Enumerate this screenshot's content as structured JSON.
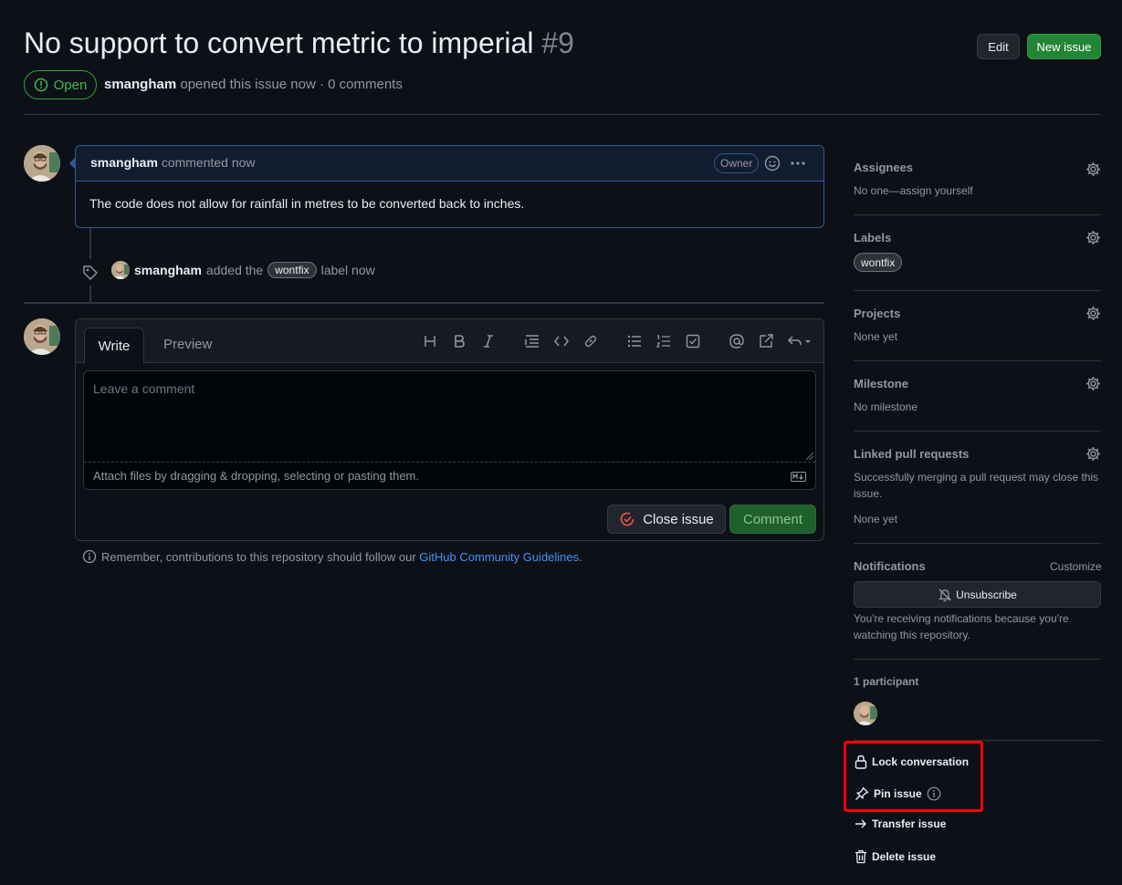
{
  "issue": {
    "title": "No support to convert metric to imperial",
    "number": "#9",
    "state": "Open",
    "author": "smangham",
    "meta_suffix": "opened this issue now · 0 comments"
  },
  "header_buttons": {
    "edit": "Edit",
    "new_issue": "New issue"
  },
  "comment": {
    "author": "smangham",
    "action": "commented now",
    "role_badge": "Owner",
    "body": "The code does not allow for rainfall in metres to be converted back to inches."
  },
  "event": {
    "actor": "smangham",
    "pre": "added the",
    "label": "wontfix",
    "post": "label now"
  },
  "editor": {
    "tabs": [
      "Write",
      "Preview"
    ],
    "placeholder": "Leave a comment",
    "attach_hint": "Attach files by dragging & dropping, selecting or pasting them.",
    "close_button": "Close issue",
    "comment_button": "Comment"
  },
  "guidelines": {
    "prefix": "Remember, contributions to this repository should follow our",
    "link": "GitHub Community Guidelines",
    "suffix": "."
  },
  "sidebar": {
    "assignees": {
      "title": "Assignees",
      "value": "No one—assign yourself"
    },
    "labels": {
      "title": "Labels",
      "value": "wontfix"
    },
    "projects": {
      "title": "Projects",
      "value": "None yet"
    },
    "milestone": {
      "title": "Milestone",
      "value": "No milestone"
    },
    "linked_prs": {
      "title": "Linked pull requests",
      "hint": "Successfully merging a pull request may close this issue.",
      "value": "None yet"
    },
    "notifications": {
      "title": "Notifications",
      "customize": "Customize",
      "button": "Unsubscribe",
      "reason": "You're receiving notifications because you're watching this repository."
    },
    "participants": {
      "title": "1 participant"
    },
    "actions": {
      "lock": "Lock conversation",
      "pin": "Pin issue",
      "transfer": "Transfer issue",
      "delete": "Delete issue"
    }
  },
  "colors": {
    "background": "#0d1117",
    "open_green": "#3fb950",
    "primary_button": "#238636",
    "link_blue": "#4493f8",
    "highlight_red": "#ff0000"
  }
}
